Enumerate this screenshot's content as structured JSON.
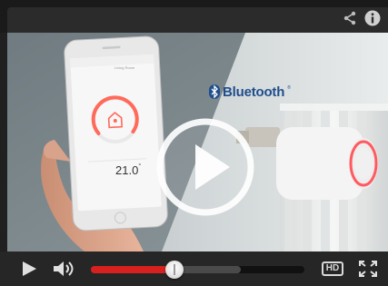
{
  "player": {
    "brand_text": "Bluetooth",
    "brand_tm": "®",
    "phone": {
      "app_name": "Living Room",
      "temperature": "21.0",
      "unit": "°"
    },
    "controls": {
      "hd_label": "HD",
      "progress_played_fraction": 0.39,
      "progress_buffered_fraction": 0.7
    },
    "icons": {
      "share": "share-icon",
      "info": "info-icon",
      "play_overlay": "play-icon",
      "play": "play-icon",
      "volume": "volume-icon",
      "fullscreen": "fullscreen-icon",
      "bluetooth": "bluetooth-icon"
    },
    "colors": {
      "progress_played": "#d8201f",
      "bluetooth_brand": "#1f4e8c",
      "thermostat_ring": "#ff5a5f"
    }
  }
}
